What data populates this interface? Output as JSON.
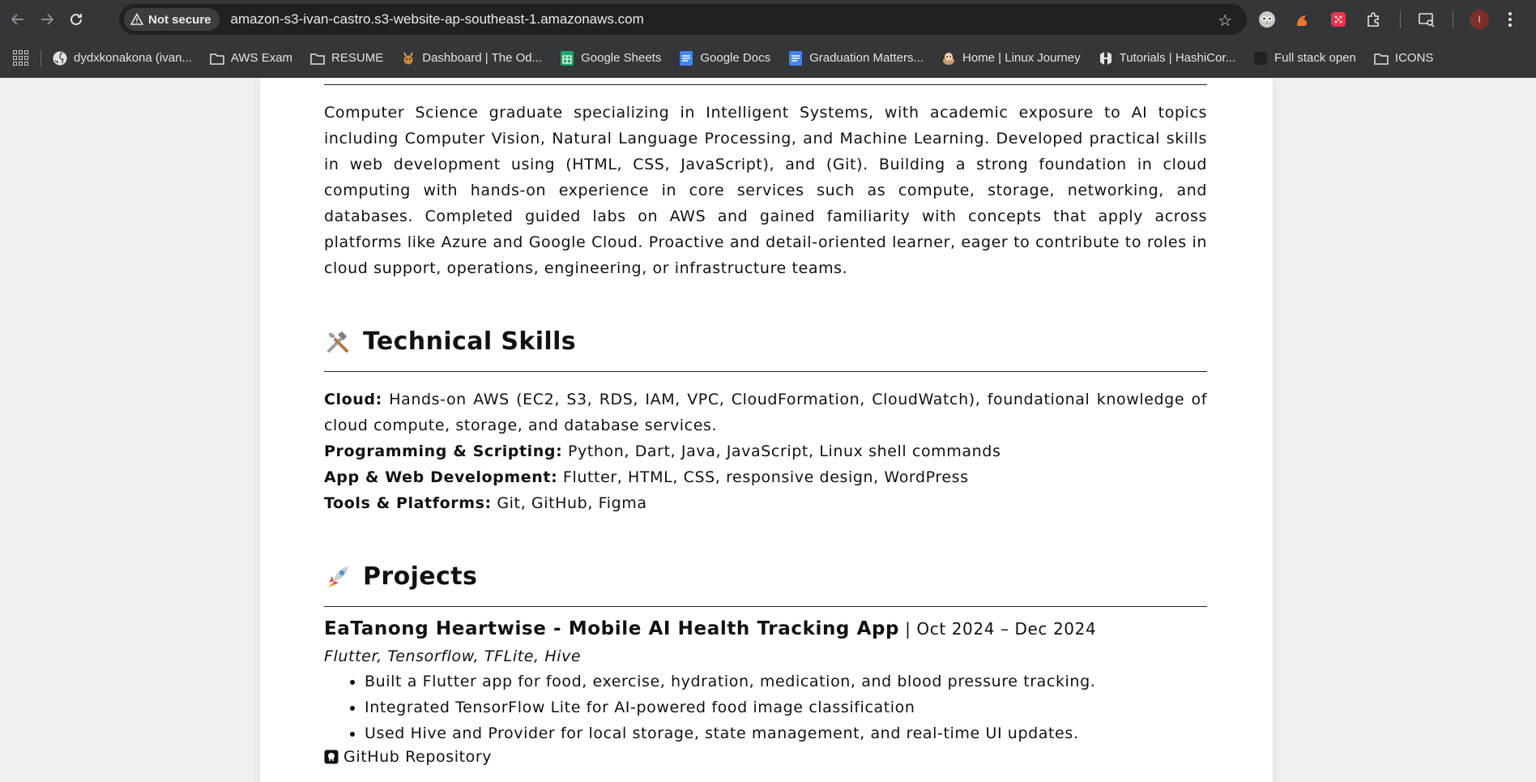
{
  "browser": {
    "security_label": "Not secure",
    "url": "amazon-s3-ivan-castro.s3-website-ap-southeast-1.amazonaws.com",
    "profile_initial": "I",
    "bookmarks": [
      {
        "label": "dydxkonakona (ivan...",
        "icon": "github-icon"
      },
      {
        "label": "AWS Exam",
        "icon": "folder-icon"
      },
      {
        "label": "RESUME",
        "icon": "folder-icon"
      },
      {
        "label": "Dashboard | The Od...",
        "icon": "odin-icon"
      },
      {
        "label": "Google Sheets",
        "icon": "sheets-icon"
      },
      {
        "label": "Google Docs",
        "icon": "docs-icon"
      },
      {
        "label": "Graduation Matters...",
        "icon": "docs-icon"
      },
      {
        "label": "Home | Linux Journey",
        "icon": "linux-icon"
      },
      {
        "label": "Tutorials | HashiCor...",
        "icon": "hashicorp-icon"
      },
      {
        "label": "Full stack open",
        "icon": "fso-icon"
      },
      {
        "label": "ICONS",
        "icon": "folder-icon"
      }
    ]
  },
  "summary": {
    "text": "Computer Science graduate specializing in Intelligent Systems, with academic exposure to AI topics including Computer Vision, Natural Language Processing, and Machine Learning. Developed practical skills in web development using (HTML, CSS, JavaScript), and (Git). Building a strong foundation in cloud computing with hands-on experience in core services such as compute, storage, networking, and databases. Completed guided labs on AWS and gained familiarity with concepts that apply across platforms like Azure and Google Cloud. Proactive and detail-oriented learner, eager to contribute to roles in cloud support, operations, engineering, or infrastructure teams."
  },
  "skills": {
    "heading": "Technical Skills",
    "items": [
      {
        "label": "Cloud:",
        "value": " Hands-on AWS (EC2, S3, RDS, IAM, VPC, CloudFormation, CloudWatch), foundational knowledge of cloud compute, storage, and database services."
      },
      {
        "label": "Programming & Scripting:",
        "value": " Python, Dart, Java, JavaScript, Linux shell commands"
      },
      {
        "label": "App & Web Development:",
        "value": " Flutter, HTML, CSS, responsive design, WordPress"
      },
      {
        "label": "Tools & Platforms:",
        "value": " Git, GitHub, Figma"
      }
    ]
  },
  "projects": {
    "heading": "Projects",
    "items": [
      {
        "title": "EaTanong Heartwise - Mobile AI Health Tracking App",
        "dates": " | Oct 2024 – Dec 2024",
        "tech": "Flutter, Tensorflow, TFLite, Hive",
        "bullets": [
          "Built a Flutter app for food, exercise, hydration, medication, and blood pressure tracking.",
          "Integrated TensorFlow Lite for AI-powered food image classification",
          "Used Hive and Provider for local storage, state management, and real-time UI updates."
        ],
        "link_label": "GitHub Repository"
      }
    ]
  }
}
